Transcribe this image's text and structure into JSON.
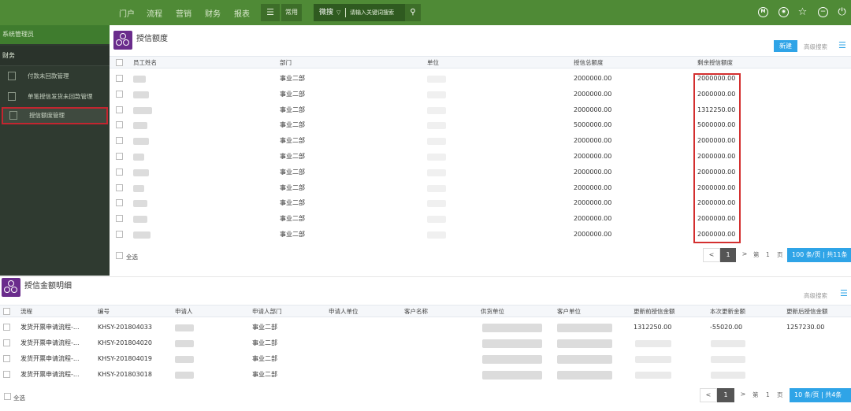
{
  "topnav": {
    "items": [
      "门户",
      "流程",
      "营销",
      "财务",
      "报表"
    ],
    "common_label": "常用",
    "search_category": "微搜",
    "search_placeholder": "请输入关键词搜索"
  },
  "sidebar": {
    "user": "系统管理员",
    "section": "财务",
    "items": [
      {
        "label": "付款未回款管理"
      },
      {
        "label": "单笔授信发货未回款管理"
      },
      {
        "label": "授信额度管理"
      }
    ]
  },
  "credit_panel": {
    "title": "授信额度",
    "new_button": "新建",
    "advanced_search": "高级搜索",
    "columns": [
      "员工姓名",
      "部门",
      "单位",
      "授信总额度",
      "剩余授信额度"
    ],
    "rows": [
      {
        "dept": "事业二部",
        "total": "2000000.00",
        "remaining": "2000000.00"
      },
      {
        "dept": "事业二部",
        "total": "2000000.00",
        "remaining": "2000000.00"
      },
      {
        "dept": "事业二部",
        "total": "2000000.00",
        "remaining": "1312250.00"
      },
      {
        "dept": "事业二部",
        "total": "5000000.00",
        "remaining": "5000000.00"
      },
      {
        "dept": "事业二部",
        "total": "2000000.00",
        "remaining": "2000000.00"
      },
      {
        "dept": "事业二部",
        "total": "2000000.00",
        "remaining": "2000000.00"
      },
      {
        "dept": "事业二部",
        "total": "2000000.00",
        "remaining": "2000000.00"
      },
      {
        "dept": "事业二部",
        "total": "2000000.00",
        "remaining": "2000000.00"
      },
      {
        "dept": "事业二部",
        "total": "2000000.00",
        "remaining": "2000000.00"
      },
      {
        "dept": "事业二部",
        "total": "2000000.00",
        "remaining": "2000000.00"
      },
      {
        "dept": "事业二部",
        "total": "2000000.00",
        "remaining": "2000000.00"
      }
    ],
    "select_all": "全选",
    "pager": {
      "prev": "<",
      "page": "1",
      "next": ">",
      "page_prefix": "第",
      "page_input": "1",
      "page_suffix": "页",
      "size": "100 条/页 | 共11条"
    }
  },
  "detail_panel": {
    "title": "授信金额明细",
    "advanced_search": "高级搜索",
    "columns": [
      "流程",
      "编号",
      "申请人",
      "申请人部门",
      "申请人单位",
      "客户名称",
      "供货单位",
      "客户单位",
      "更新前授信金额",
      "本次更新金额",
      "更新后授信金额"
    ],
    "rows": [
      {
        "flow": "发货开票申请流程-...",
        "no": "KHSY-201804033",
        "dept": "事业二部",
        "before": "1312250.00",
        "change": "-55020.00",
        "after": "1257230.00"
      },
      {
        "flow": "发货开票申请流程-...",
        "no": "KHSY-201804020",
        "dept": "事业二部",
        "before": "",
        "change": "",
        "after": ""
      },
      {
        "flow": "发货开票申请流程-...",
        "no": "KHSY-201804019",
        "dept": "事业二部",
        "before": "",
        "change": "",
        "after": ""
      },
      {
        "flow": "发货开票申请流程-...",
        "no": "KHSY-201803018",
        "dept": "事业二部",
        "before": "",
        "change": "",
        "after": ""
      }
    ],
    "select_all": "全选",
    "pager": {
      "prev": "<",
      "page": "1",
      "next": ">",
      "page_prefix": "第",
      "page_input": "1",
      "page_suffix": "页",
      "size": "10 条/页 | 共4条"
    }
  }
}
